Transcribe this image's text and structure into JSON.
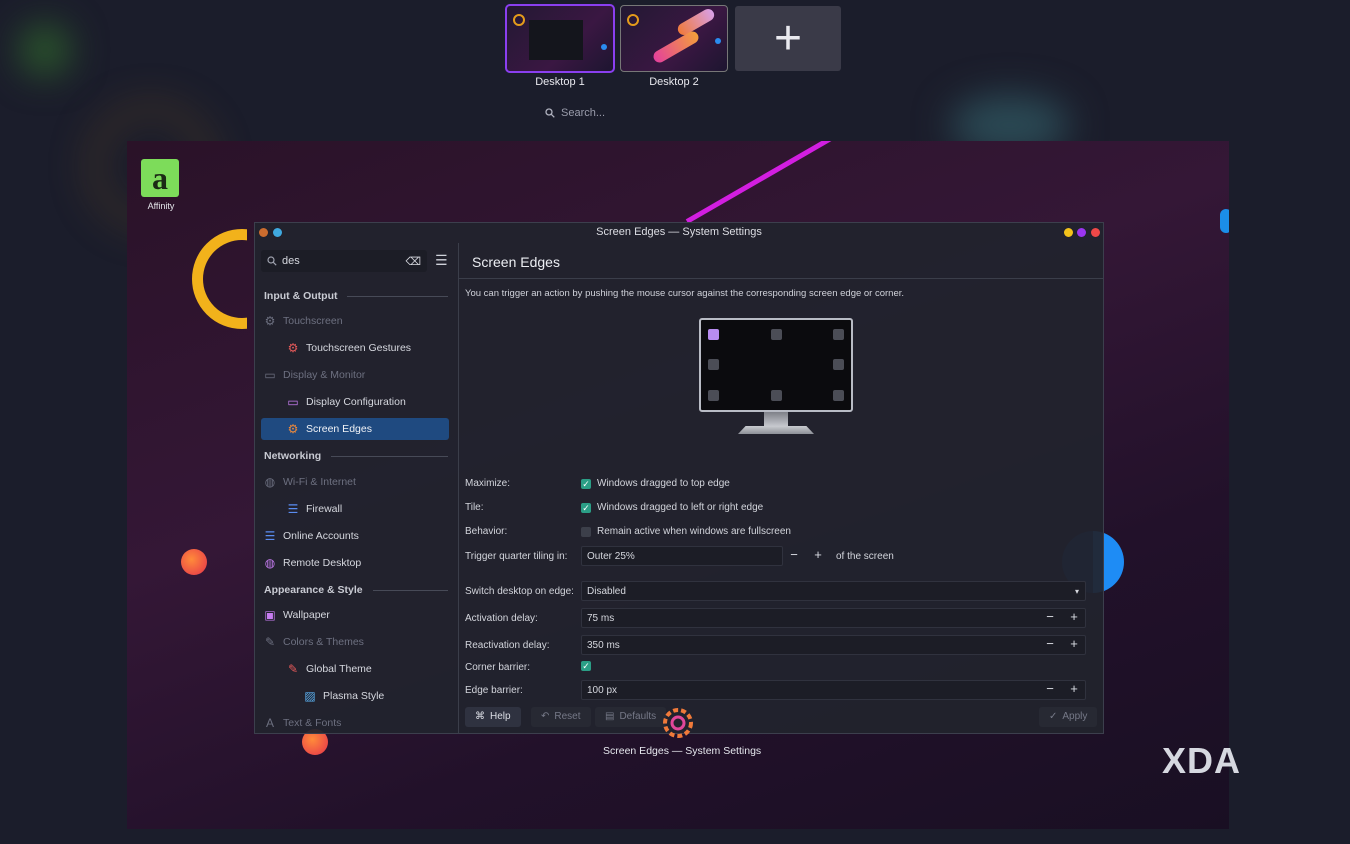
{
  "pager": {
    "desktops": [
      {
        "label": "Desktop 1"
      },
      {
        "label": "Desktop 2"
      }
    ],
    "add_icon": "plus-icon",
    "search_placeholder": "Search..."
  },
  "desktop": {
    "affinity_label": "Affinity",
    "affinity_glyph": "a"
  },
  "window": {
    "title": "Screen Edges — System Settings",
    "search_value": "des",
    "colors": {
      "accent": "#1f4a80",
      "checkbox": "#2b9e86",
      "stripe": "#d21ee0"
    },
    "sidebar": {
      "sections": [
        {
          "label": "Input & Output"
        },
        {
          "label": "Networking"
        },
        {
          "label": "Appearance & Style"
        }
      ],
      "items": [
        {
          "label": "Touchscreen"
        },
        {
          "label": "Touchscreen Gestures"
        },
        {
          "label": "Display & Monitor"
        },
        {
          "label": "Display Configuration"
        },
        {
          "label": "Screen Edges"
        },
        {
          "label": "Wi-Fi & Internet"
        },
        {
          "label": "Firewall"
        },
        {
          "label": "Online Accounts"
        },
        {
          "label": "Remote Desktop"
        },
        {
          "label": "Wallpaper"
        },
        {
          "label": "Colors & Themes"
        },
        {
          "label": "Global Theme"
        },
        {
          "label": "Plasma Style"
        },
        {
          "label": "Text & Fonts"
        }
      ]
    },
    "page": {
      "title": "Screen Edges",
      "description": "You can trigger an action by pushing the mouse cursor against the corresponding screen edge or corner.",
      "maximize": {
        "label": "Maximize:",
        "text": "Windows dragged to top edge",
        "checked": true
      },
      "tile": {
        "label": "Tile:",
        "text": "Windows dragged to left or right edge",
        "checked": true
      },
      "behavior": {
        "label": "Behavior:",
        "text": "Remain active when windows are fullscreen",
        "checked": false
      },
      "quarter": {
        "label": "Trigger quarter tiling in:",
        "value": "Outer 25%",
        "suffix": "of the screen"
      },
      "switch_desktop": {
        "label": "Switch desktop on edge:",
        "value": "Disabled"
      },
      "activation_delay": {
        "label": "Activation delay:",
        "value": "75 ms"
      },
      "reactivation_delay": {
        "label": "Reactivation delay:",
        "value": "350 ms"
      },
      "corner_barrier": {
        "label": "Corner barrier:",
        "checked": true
      },
      "edge_barrier": {
        "label": "Edge barrier:",
        "value": "100 px"
      }
    },
    "buttons": {
      "help": "Help",
      "reset": "Reset",
      "defaults": "Defaults",
      "apply": "Apply"
    }
  },
  "taskbar": {
    "label": "Screen Edges — System Settings"
  },
  "watermark": "XDA"
}
